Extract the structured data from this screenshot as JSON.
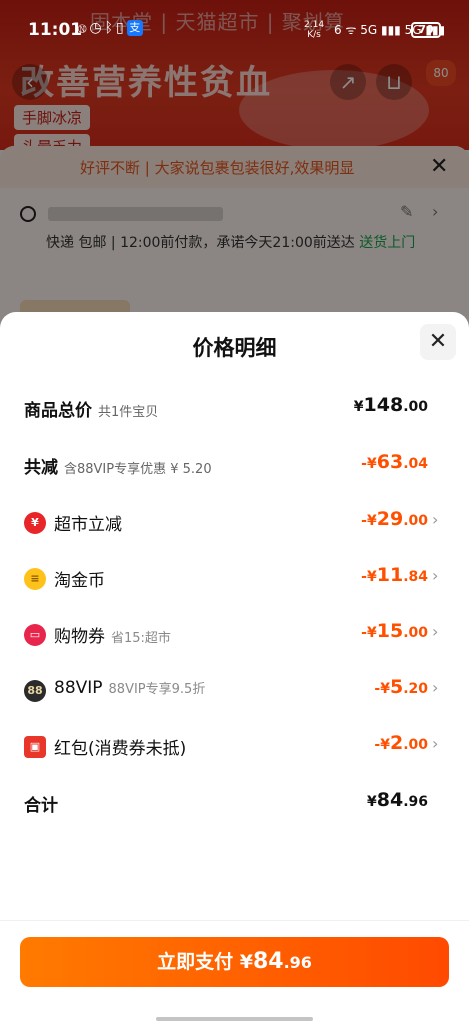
{
  "status_bar": {
    "time": "11:01",
    "left_icons": [
      "nfc-icon",
      "alarm-icon",
      "bluetooth-icon",
      "vibrate-icon",
      "alipay-icon"
    ],
    "net_speed": "2.14",
    "net_unit": "K/s",
    "signal_text": "6 ᯤ 5G ▮▮▮ 5G ▮▮▮",
    "battery": "70"
  },
  "background": {
    "brand": "固本堂 | 天猫超市 | 聚划算",
    "headline": "改善营养性贫血",
    "tags": [
      "手脚冰凉",
      "头晕乏力"
    ],
    "cart_badge": "80",
    "notice": "好评不断 | 大家说包裹包装很好,效果明显",
    "shipping": "快递 包邮 | 12:00前付款，承诺今天21:00前送达",
    "shipping_highlight": "送货上门"
  },
  "sheet": {
    "title": "价格明细",
    "rows": [
      {
        "label": "商品总价",
        "sub": "共1件宝贝",
        "currency": "¥",
        "int": "148",
        "dec": ".00",
        "sign": ""
      },
      {
        "label": "共减",
        "sub": "含88VIP专享优惠 ¥ 5.20",
        "currency": "¥",
        "int": "63",
        "dec": ".04",
        "sign": "-"
      },
      {
        "label": "超市立减",
        "sub": "",
        "currency": "¥",
        "int": "29",
        "dec": ".00",
        "sign": "-",
        "icon": "supermarket-discount-icon",
        "icon_glyph": "¥"
      },
      {
        "label": "淘金币",
        "sub": "",
        "currency": "¥",
        "int": "11",
        "dec": ".84",
        "sign": "-",
        "icon": "gold-coin-icon",
        "icon_glyph": "≡"
      },
      {
        "label": "购物券",
        "sub": "省15:超市",
        "currency": "¥",
        "int": "15",
        "dec": ".00",
        "sign": "-",
        "icon": "shopping-coupon-icon",
        "icon_glyph": "▭"
      },
      {
        "label": "88VIP",
        "sub": "88VIP专享9.5折",
        "currency": "¥",
        "int": "5",
        "dec": ".20",
        "sign": "-",
        "icon": "vip88-icon",
        "icon_glyph": "88"
      },
      {
        "label": "红包(消费券未抵)",
        "sub": "",
        "currency": "¥",
        "int": "2",
        "dec": ".00",
        "sign": "-",
        "icon": "red-envelope-icon",
        "icon_glyph": "▣"
      },
      {
        "label": "合计",
        "sub": "",
        "currency": "¥",
        "int": "84",
        "dec": ".96",
        "sign": ""
      }
    ]
  },
  "pay_button": {
    "label": "立即支付",
    "currency": "¥",
    "int": "84",
    "dec": ".96"
  },
  "colors": {
    "accent": "#ff5000",
    "pay_start": "#ff7a00",
    "pay_end": "#ff4a00"
  }
}
